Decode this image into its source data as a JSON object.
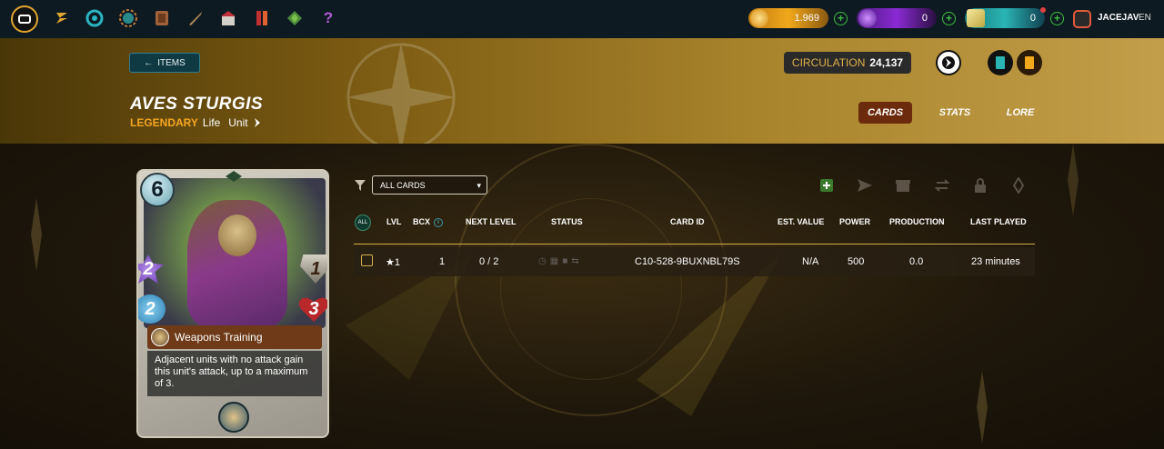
{
  "nav": {
    "icons": [
      "monster-logo-icon",
      "rewards-icon",
      "vortex-icon",
      "guild-icon",
      "collection-icon",
      "weapons-icon",
      "market-icon",
      "banner-icon",
      "land-icon",
      "help-icon"
    ],
    "help_glyph": "?"
  },
  "currencies": [
    {
      "name": "dec",
      "value": "1.969",
      "color": "#f2a81c"
    },
    {
      "name": "sps",
      "value": "0",
      "color": "#8a2ad4"
    },
    {
      "name": "vouchers",
      "value": "0",
      "color": "#2ab4b4"
    }
  ],
  "user": {
    "name": "JACEJAV",
    "lang": "EN"
  },
  "header": {
    "back_button": "ITEMS",
    "back_arrow": "←",
    "title": "AVES STURGIS",
    "rarity": "LEGENDARY",
    "element": "Life",
    "type": "Unit",
    "circulation_label": "CIRCULATION",
    "circulation_value": "24,137",
    "tabs": [
      "CARDS",
      "STATS",
      "LORE"
    ],
    "active_tab": "CARDS"
  },
  "card": {
    "mana": "6",
    "melee": "2",
    "speed": "2",
    "armor": "1",
    "health": "3",
    "ability_name": "Weapons Training",
    "ability_desc": "Adjacent units with no attack gain this unit's attack, up to a maximum of 3."
  },
  "filters": {
    "select_value": "ALL CARDS",
    "select_caret": "▾",
    "actions": [
      "add-card-icon",
      "send-icon",
      "market-icon",
      "transfer-icon",
      "lock-icon",
      "burn-icon"
    ]
  },
  "table": {
    "all_label": "ALL",
    "headers": [
      "LVL",
      "BCX",
      "NEXT LEVEL",
      "STATUS",
      "CARD ID",
      "EST. VALUE",
      "POWER",
      "PRODUCTION",
      "LAST PLAYED"
    ],
    "info_glyph": "i",
    "rows": [
      {
        "lvl": "★1",
        "bcx": "1",
        "next_level": "0 / 2",
        "card_id": "C10-528-9BUXNBL79S",
        "est_value": "N/A",
        "power": "500",
        "production": "0.0",
        "last_played": "23 minutes"
      }
    ]
  }
}
